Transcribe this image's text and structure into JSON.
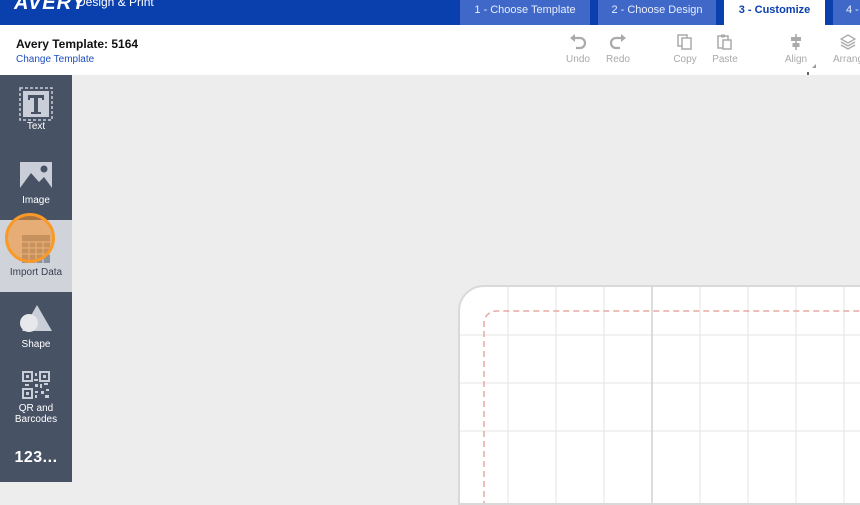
{
  "app": {
    "logo_text": "AVERY",
    "brand_subtitle": "Design & Print"
  },
  "steps": [
    {
      "label": "1 - Choose Template",
      "active": false
    },
    {
      "label": "2 - Choose Design",
      "active": false
    },
    {
      "label": "3 - Customize",
      "active": true
    },
    {
      "label": "4 -",
      "active": false
    }
  ],
  "header": {
    "template_title": "Avery Template: 5164",
    "change_template_link": "Change Template"
  },
  "toolbar": {
    "undo": "Undo",
    "redo": "Redo",
    "copy": "Copy",
    "paste": "Paste",
    "align": "Align",
    "arrange": "Arrang"
  },
  "sidebar": {
    "items": [
      {
        "label": "Text",
        "icon": "text-icon"
      },
      {
        "label": "Image",
        "icon": "image-icon"
      },
      {
        "label": "Import Data",
        "icon": "table-icon",
        "active": true
      },
      {
        "label": "Shape",
        "icon": "shape-icon"
      },
      {
        "label": "QR and Barcodes",
        "icon": "qr-code-icon"
      },
      {
        "label": "123...",
        "icon": "sequential-numbers-icon"
      }
    ]
  },
  "colors": {
    "brand_blue": "#0a3fae",
    "sidebar_bg": "#475264",
    "highlight_orange": "#f79a2a",
    "safe_zone_dash": "#e8a8a0"
  }
}
